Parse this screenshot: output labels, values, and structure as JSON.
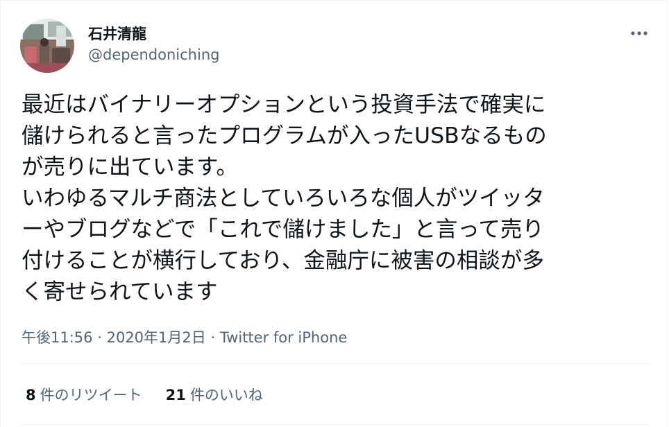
{
  "user": {
    "display_name": "石井清龍",
    "handle": "@dependoniching"
  },
  "tweet": {
    "text": "最近はバイナリーオプションという投資手法で確実に\n儲けられると言ったプログラムが入ったUSBなるもの\nが売りに出ています。\nいわゆるマルチ商法としていろいろな個人がツイッタ\nーやブログなどで「これで儲けました」と言って売り\n付けることが横行しており、金融庁に被害の相談が多\nく寄せられています"
  },
  "meta": {
    "time": "午後11:56",
    "separator1": "·",
    "date": "2020年1月2日",
    "separator2": "·",
    "source": "Twitter for iPhone"
  },
  "stats": {
    "retweets_count": "8",
    "retweets_label": "件のリツイート",
    "likes_count": "21",
    "likes_label": "件のいいね"
  },
  "icons": {
    "more": "more-horizontal-icon"
  },
  "colors": {
    "text_primary": "#0f1419",
    "text_secondary": "#536471",
    "divider": "#eff3f4"
  }
}
